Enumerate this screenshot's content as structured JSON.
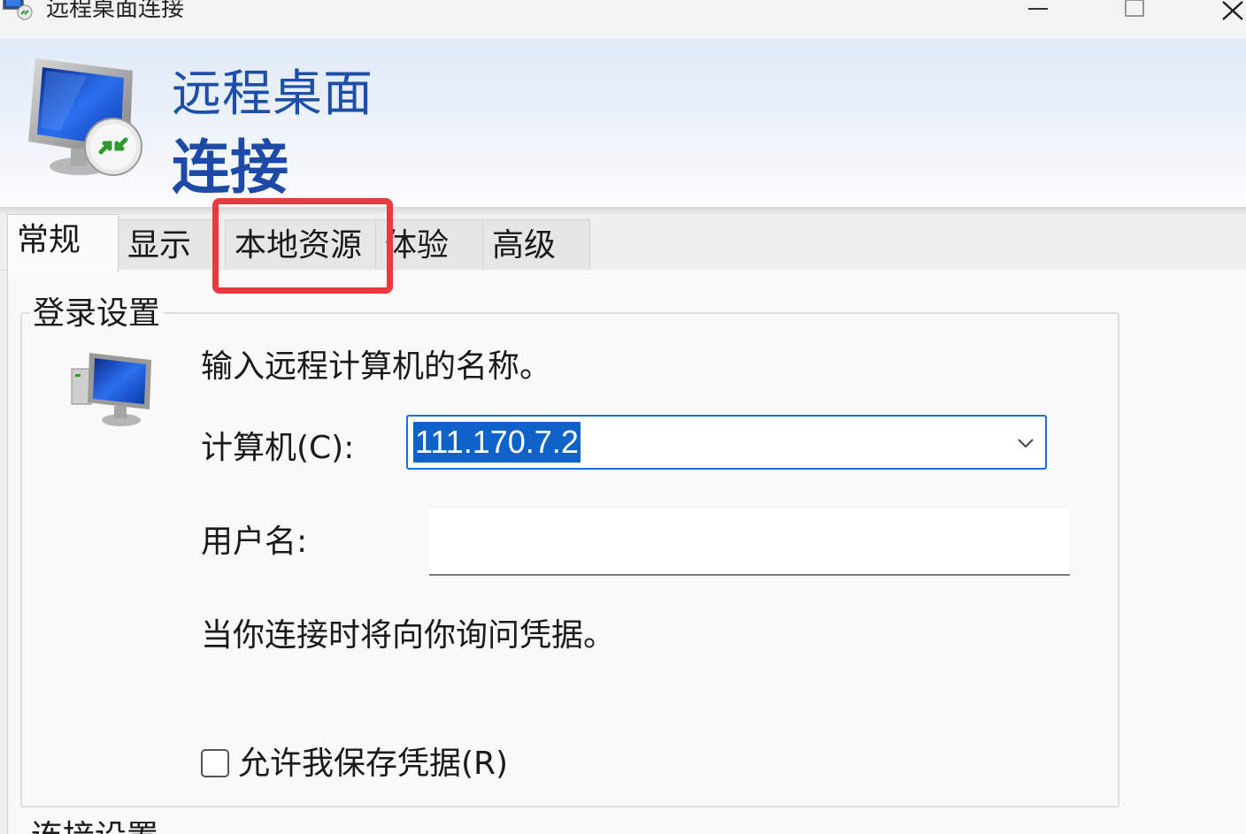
{
  "window": {
    "title": "远程桌面连接"
  },
  "banner": {
    "line1": "远程桌面",
    "line2": "连接"
  },
  "tabs": [
    {
      "label": "常规",
      "active": true
    },
    {
      "label": "显示",
      "active": false
    },
    {
      "label": "本地资源",
      "active": false
    },
    {
      "label": "体验",
      "active": false
    },
    {
      "label": "高级",
      "active": false
    }
  ],
  "login_group": {
    "legend": "登录设置",
    "prompt": "输入远程计算机的名称。",
    "computer_label": "计算机(C):",
    "computer_value": "111.170.7.2",
    "username_label": "用户名:",
    "username_value": "",
    "info_text": "当你连接时将向你询问凭据。",
    "save_credentials_label": "允许我保存凭据(R)",
    "save_credentials_checked": false
  },
  "next_group": {
    "legend": "连接设置"
  },
  "colors": {
    "banner_text": "#1e4fa8",
    "selection": "#0f62c8",
    "highlight_box": "#ea3a3d"
  },
  "icons": {
    "app": "remote-desktop-icon",
    "banner": "remote-desktop-monitor-icon",
    "computer": "computer-monitor-icon",
    "dropdown": "chevron-down-icon"
  }
}
